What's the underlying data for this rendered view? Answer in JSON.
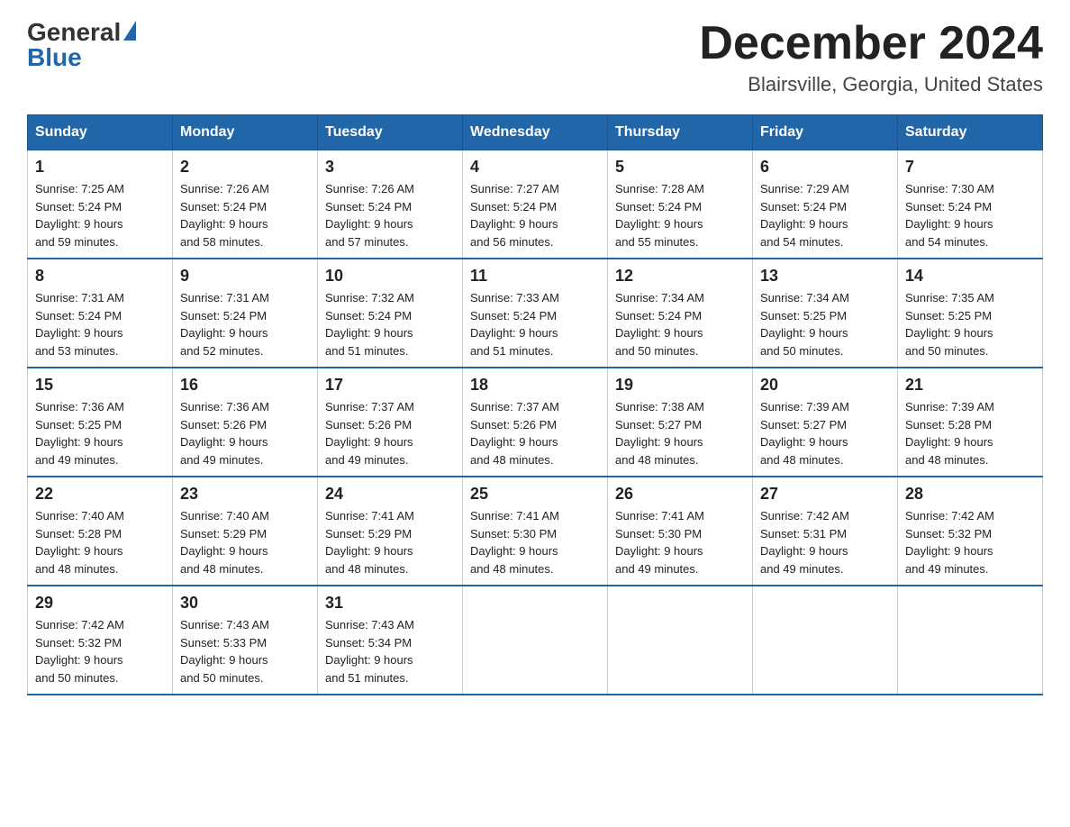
{
  "logo": {
    "general": "General",
    "blue": "Blue"
  },
  "title": "December 2024",
  "location": "Blairsville, Georgia, United States",
  "days_of_week": [
    "Sunday",
    "Monday",
    "Tuesday",
    "Wednesday",
    "Thursday",
    "Friday",
    "Saturday"
  ],
  "weeks": [
    [
      {
        "day": "1",
        "sunrise": "7:25 AM",
        "sunset": "5:24 PM",
        "daylight": "9 hours and 59 minutes."
      },
      {
        "day": "2",
        "sunrise": "7:26 AM",
        "sunset": "5:24 PM",
        "daylight": "9 hours and 58 minutes."
      },
      {
        "day": "3",
        "sunrise": "7:26 AM",
        "sunset": "5:24 PM",
        "daylight": "9 hours and 57 minutes."
      },
      {
        "day": "4",
        "sunrise": "7:27 AM",
        "sunset": "5:24 PM",
        "daylight": "9 hours and 56 minutes."
      },
      {
        "day": "5",
        "sunrise": "7:28 AM",
        "sunset": "5:24 PM",
        "daylight": "9 hours and 55 minutes."
      },
      {
        "day": "6",
        "sunrise": "7:29 AM",
        "sunset": "5:24 PM",
        "daylight": "9 hours and 54 minutes."
      },
      {
        "day": "7",
        "sunrise": "7:30 AM",
        "sunset": "5:24 PM",
        "daylight": "9 hours and 54 minutes."
      }
    ],
    [
      {
        "day": "8",
        "sunrise": "7:31 AM",
        "sunset": "5:24 PM",
        "daylight": "9 hours and 53 minutes."
      },
      {
        "day": "9",
        "sunrise": "7:31 AM",
        "sunset": "5:24 PM",
        "daylight": "9 hours and 52 minutes."
      },
      {
        "day": "10",
        "sunrise": "7:32 AM",
        "sunset": "5:24 PM",
        "daylight": "9 hours and 51 minutes."
      },
      {
        "day": "11",
        "sunrise": "7:33 AM",
        "sunset": "5:24 PM",
        "daylight": "9 hours and 51 minutes."
      },
      {
        "day": "12",
        "sunrise": "7:34 AM",
        "sunset": "5:24 PM",
        "daylight": "9 hours and 50 minutes."
      },
      {
        "day": "13",
        "sunrise": "7:34 AM",
        "sunset": "5:25 PM",
        "daylight": "9 hours and 50 minutes."
      },
      {
        "day": "14",
        "sunrise": "7:35 AM",
        "sunset": "5:25 PM",
        "daylight": "9 hours and 50 minutes."
      }
    ],
    [
      {
        "day": "15",
        "sunrise": "7:36 AM",
        "sunset": "5:25 PM",
        "daylight": "9 hours and 49 minutes."
      },
      {
        "day": "16",
        "sunrise": "7:36 AM",
        "sunset": "5:26 PM",
        "daylight": "9 hours and 49 minutes."
      },
      {
        "day": "17",
        "sunrise": "7:37 AM",
        "sunset": "5:26 PM",
        "daylight": "9 hours and 49 minutes."
      },
      {
        "day": "18",
        "sunrise": "7:37 AM",
        "sunset": "5:26 PM",
        "daylight": "9 hours and 48 minutes."
      },
      {
        "day": "19",
        "sunrise": "7:38 AM",
        "sunset": "5:27 PM",
        "daylight": "9 hours and 48 minutes."
      },
      {
        "day": "20",
        "sunrise": "7:39 AM",
        "sunset": "5:27 PM",
        "daylight": "9 hours and 48 minutes."
      },
      {
        "day": "21",
        "sunrise": "7:39 AM",
        "sunset": "5:28 PM",
        "daylight": "9 hours and 48 minutes."
      }
    ],
    [
      {
        "day": "22",
        "sunrise": "7:40 AM",
        "sunset": "5:28 PM",
        "daylight": "9 hours and 48 minutes."
      },
      {
        "day": "23",
        "sunrise": "7:40 AM",
        "sunset": "5:29 PM",
        "daylight": "9 hours and 48 minutes."
      },
      {
        "day": "24",
        "sunrise": "7:41 AM",
        "sunset": "5:29 PM",
        "daylight": "9 hours and 48 minutes."
      },
      {
        "day": "25",
        "sunrise": "7:41 AM",
        "sunset": "5:30 PM",
        "daylight": "9 hours and 48 minutes."
      },
      {
        "day": "26",
        "sunrise": "7:41 AM",
        "sunset": "5:30 PM",
        "daylight": "9 hours and 49 minutes."
      },
      {
        "day": "27",
        "sunrise": "7:42 AM",
        "sunset": "5:31 PM",
        "daylight": "9 hours and 49 minutes."
      },
      {
        "day": "28",
        "sunrise": "7:42 AM",
        "sunset": "5:32 PM",
        "daylight": "9 hours and 49 minutes."
      }
    ],
    [
      {
        "day": "29",
        "sunrise": "7:42 AM",
        "sunset": "5:32 PM",
        "daylight": "9 hours and 50 minutes."
      },
      {
        "day": "30",
        "sunrise": "7:43 AM",
        "sunset": "5:33 PM",
        "daylight": "9 hours and 50 minutes."
      },
      {
        "day": "31",
        "sunrise": "7:43 AM",
        "sunset": "5:34 PM",
        "daylight": "9 hours and 51 minutes."
      },
      null,
      null,
      null,
      null
    ]
  ],
  "labels": {
    "sunrise": "Sunrise: ",
    "sunset": "Sunset: ",
    "daylight": "Daylight: "
  }
}
